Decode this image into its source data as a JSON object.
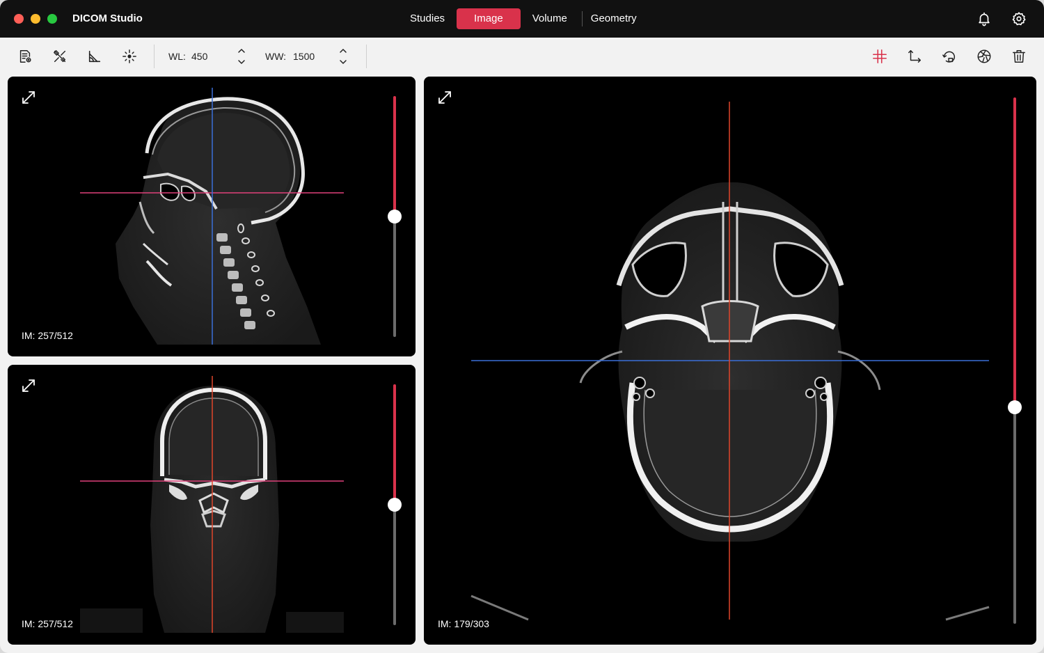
{
  "app": {
    "title": "DICOM Studio"
  },
  "nav": {
    "tabs": [
      {
        "label": "Studies",
        "active": false
      },
      {
        "label": "Image",
        "active": true
      },
      {
        "label": "Volume",
        "active": false
      },
      {
        "label": "Geometry",
        "active": false
      }
    ]
  },
  "titlebar_icons": [
    "bell-icon",
    "gear-icon"
  ],
  "toolbar": {
    "left_icons": [
      "report-settings-icon",
      "tools-icon",
      "angle-measure-icon",
      "crosshair-center-icon"
    ],
    "wl_label": "WL:",
    "wl_value": "450",
    "ww_label": "WW:",
    "ww_value": "1500",
    "right_icons": [
      "crosshair-icon",
      "axis-icon",
      "rotate-icon",
      "aperture-icon",
      "trash-icon"
    ]
  },
  "viewports": [
    {
      "name": "sagittal",
      "slice_label": "IM: 257/512",
      "slider_level": 0.5
    },
    {
      "name": "coronal",
      "slice_label": "IM: 257/512",
      "slider_level": 0.5
    },
    {
      "name": "axial",
      "slice_label": "IM: 179/303",
      "slider_level": 0.59
    }
  ],
  "colors": {
    "accent": "#d9324b",
    "crosshair_pink": "#e0417a",
    "crosshair_blue": "#3a6fd8",
    "crosshair_red": "#e0452a"
  }
}
